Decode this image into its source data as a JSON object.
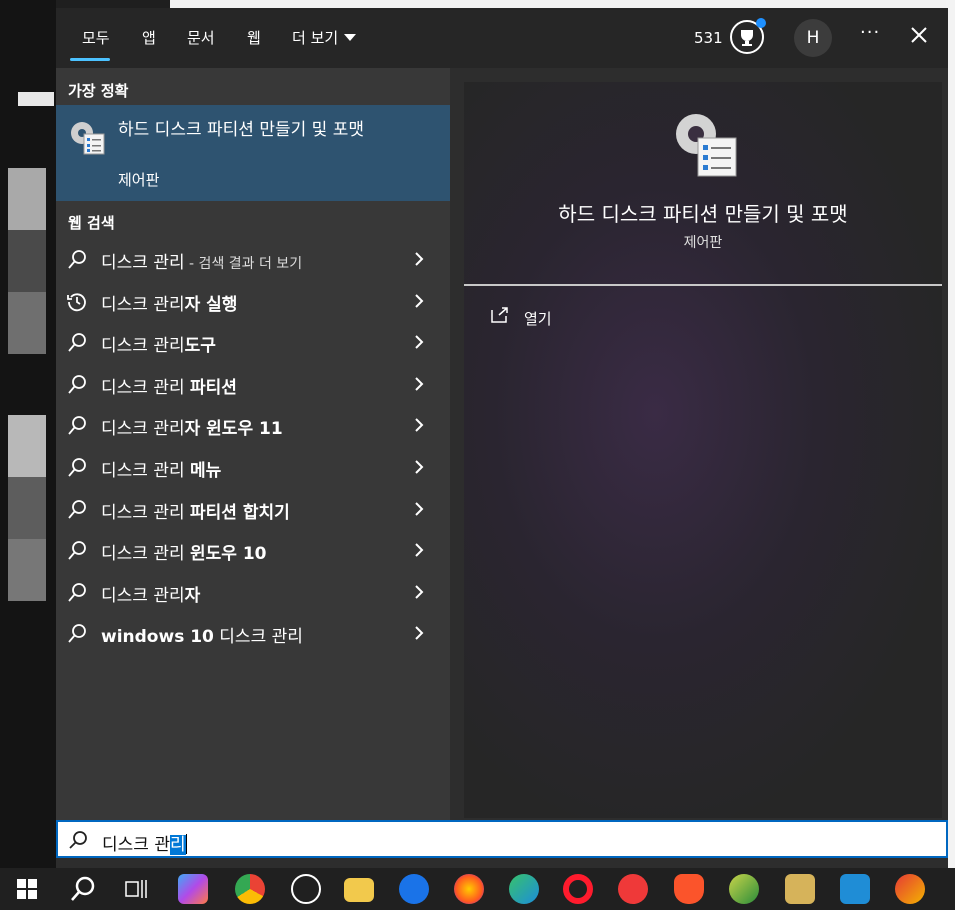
{
  "window": {
    "tabs": [
      "모두",
      "앱",
      "문서",
      "웹",
      "더 보기"
    ],
    "points": "531",
    "avatar_initial": "H",
    "more_label": "···"
  },
  "left": {
    "best_match_heading": "가장 정확",
    "best_match": {
      "title": "하드 디스크 파티션 만들기 및 포맷",
      "subtitle": "제어판",
      "icon": "disk-settings-icon"
    },
    "web_heading": "웹 검색",
    "web_results": [
      {
        "prefix": "디스크 관리",
        "bold": "",
        "suffix": " - 검색 결과 더 보기",
        "icon": "search-icon"
      },
      {
        "prefix": "디스크 관리",
        "bold": "자 실행",
        "suffix": "",
        "icon": "history-icon"
      },
      {
        "prefix": "디스크 관리",
        "bold": "도구",
        "suffix": "",
        "icon": "search-icon"
      },
      {
        "prefix": "디스크 관리 ",
        "bold": "파티션",
        "suffix": "",
        "icon": "search-icon"
      },
      {
        "prefix": "디스크 관리",
        "bold": "자 윈도우 11",
        "suffix": "",
        "icon": "search-icon"
      },
      {
        "prefix": "디스크 관리 ",
        "bold": "메뉴",
        "suffix": "",
        "icon": "search-icon"
      },
      {
        "prefix": "디스크 관리 ",
        "bold": "파티션 합치기",
        "suffix": "",
        "icon": "search-icon"
      },
      {
        "prefix": "디스크 관리 ",
        "bold": "윈도우 10",
        "suffix": "",
        "icon": "search-icon"
      },
      {
        "prefix": "디스크 관리",
        "bold": "자",
        "suffix": "",
        "icon": "search-icon"
      },
      {
        "prefix": "",
        "bold": "windows 10",
        "suffix": " 디스크 관리",
        "icon": "search-icon"
      }
    ]
  },
  "preview": {
    "title": "하드 디스크 파티션 만들기 및 포맷",
    "subtitle": "제어판",
    "open_label": "열기"
  },
  "search": {
    "value_plain": "디스크 관",
    "value_selected": "리"
  },
  "colors": {
    "accent": "#4cc2ff",
    "selection": "#2e5370",
    "focus_border": "#0067c0"
  },
  "taskbar": {
    "items": [
      "start-icon",
      "search-icon",
      "task-view-icon",
      "copilot-icon",
      "chrome-icon",
      "chatgpt-icon",
      "file-explorer-icon",
      "thunderbird-icon",
      "firefox-icon",
      "edge-icon",
      "opera-icon",
      "vivaldi-icon",
      "brave-icon",
      "app-icon",
      "notes-icon",
      "snagit-icon",
      "ccleaner-icon"
    ]
  }
}
